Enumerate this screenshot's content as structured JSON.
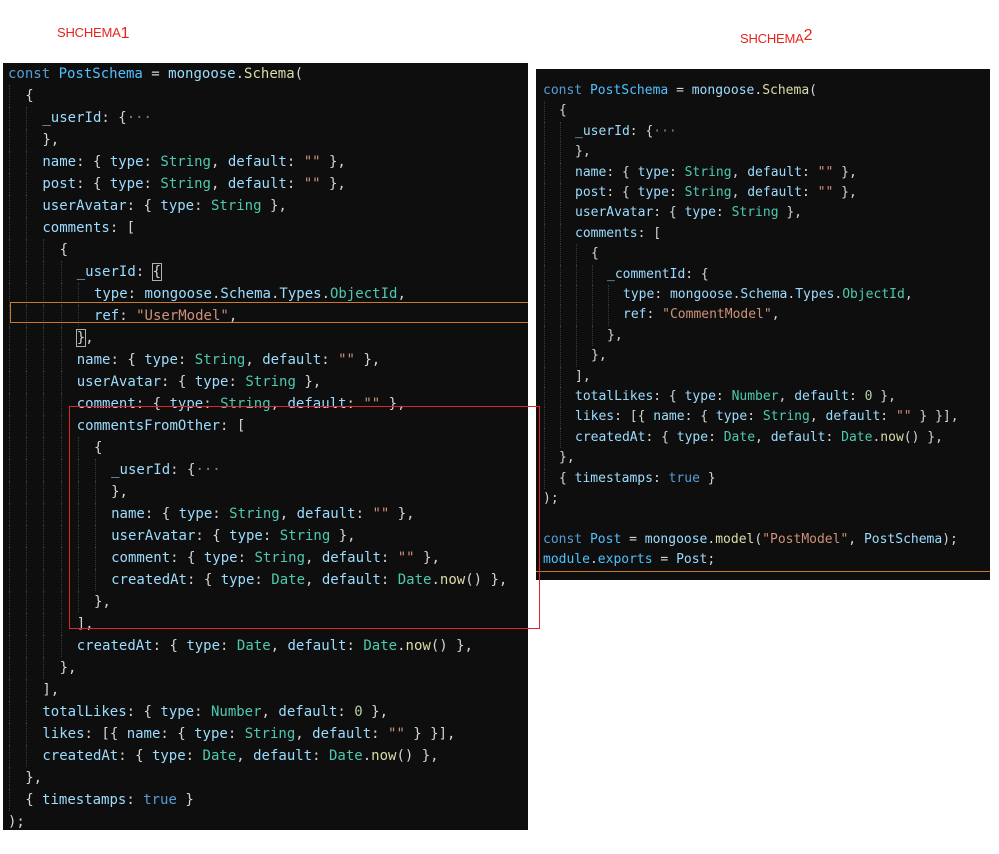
{
  "labels": {
    "schema1": {
      "text": "SHCHEMA",
      "num": "1"
    },
    "schema2": {
      "text": "SHCHEMA",
      "num": "2"
    }
  },
  "schema1": [
    [
      0,
      [
        [
          "kw",
          "const "
        ],
        [
          "var",
          "PostSchema"
        ],
        [
          "punc",
          " = "
        ],
        [
          "prop",
          "mongoose"
        ],
        [
          "punc",
          "."
        ],
        [
          "fn",
          "Schema"
        ],
        [
          "punc",
          "("
        ]
      ]
    ],
    [
      1,
      [
        [
          "punc",
          "{"
        ]
      ]
    ],
    [
      2,
      [
        [
          "prop",
          "_userId"
        ],
        [
          "punc",
          ": {"
        ],
        [
          "dim",
          "···"
        ]
      ]
    ],
    [
      2,
      [
        [
          "punc",
          "},"
        ]
      ]
    ],
    [
      2,
      [
        [
          "prop",
          "name"
        ],
        [
          "punc",
          ": { "
        ],
        [
          "prop",
          "type"
        ],
        [
          "punc",
          ": "
        ],
        [
          "type",
          "String"
        ],
        [
          "punc",
          ", "
        ],
        [
          "prop",
          "default"
        ],
        [
          "punc",
          ": "
        ],
        [
          "str",
          "\"\""
        ],
        [
          "punc",
          " },"
        ]
      ]
    ],
    [
      2,
      [
        [
          "prop",
          "post"
        ],
        [
          "punc",
          ": { "
        ],
        [
          "prop",
          "type"
        ],
        [
          "punc",
          ": "
        ],
        [
          "type",
          "String"
        ],
        [
          "punc",
          ", "
        ],
        [
          "prop",
          "default"
        ],
        [
          "punc",
          ": "
        ],
        [
          "str",
          "\"\""
        ],
        [
          "punc",
          " },"
        ]
      ]
    ],
    [
      2,
      [
        [
          "prop",
          "userAvatar"
        ],
        [
          "punc",
          ": { "
        ],
        [
          "prop",
          "type"
        ],
        [
          "punc",
          ": "
        ],
        [
          "type",
          "String"
        ],
        [
          "punc",
          " },"
        ]
      ]
    ],
    [
      2,
      [
        [
          "prop",
          "comments"
        ],
        [
          "punc",
          ": ["
        ]
      ]
    ],
    [
      3,
      [
        [
          "punc",
          "{"
        ]
      ]
    ],
    [
      4,
      [
        [
          "prop",
          "_userId"
        ],
        [
          "punc",
          ": "
        ],
        [
          "bracket",
          "{"
        ]
      ]
    ],
    [
      5,
      [
        [
          "prop",
          "type"
        ],
        [
          "punc",
          ": "
        ],
        [
          "prop",
          "mongoose"
        ],
        [
          "punc",
          "."
        ],
        [
          "prop",
          "Schema"
        ],
        [
          "punc",
          "."
        ],
        [
          "prop",
          "Types"
        ],
        [
          "punc",
          "."
        ],
        [
          "type",
          "ObjectId"
        ],
        [
          "punc",
          ","
        ]
      ]
    ],
    [
      5,
      [
        [
          "prop",
          "ref"
        ],
        [
          "punc",
          ": "
        ],
        [
          "str",
          "\"UserModel\""
        ],
        [
          "punc",
          ","
        ]
      ]
    ],
    [
      4,
      [
        [
          "bracket",
          "}"
        ],
        [
          "punc",
          ","
        ]
      ]
    ],
    [
      4,
      [
        [
          "prop",
          "name"
        ],
        [
          "punc",
          ": { "
        ],
        [
          "prop",
          "type"
        ],
        [
          "punc",
          ": "
        ],
        [
          "type",
          "String"
        ],
        [
          "punc",
          ", "
        ],
        [
          "prop",
          "default"
        ],
        [
          "punc",
          ": "
        ],
        [
          "str",
          "\"\""
        ],
        [
          "punc",
          " },"
        ]
      ]
    ],
    [
      4,
      [
        [
          "prop",
          "userAvatar"
        ],
        [
          "punc",
          ": { "
        ],
        [
          "prop",
          "type"
        ],
        [
          "punc",
          ": "
        ],
        [
          "type",
          "String"
        ],
        [
          "punc",
          " },"
        ]
      ]
    ],
    [
      4,
      [
        [
          "prop",
          "comment"
        ],
        [
          "punc",
          ": { "
        ],
        [
          "prop",
          "type"
        ],
        [
          "punc",
          ": "
        ],
        [
          "type",
          "String"
        ],
        [
          "punc",
          ", "
        ],
        [
          "prop",
          "default"
        ],
        [
          "punc",
          ": "
        ],
        [
          "str",
          "\"\""
        ],
        [
          "punc",
          " },"
        ]
      ]
    ],
    [
      4,
      [
        [
          "prop",
          "commentsFromOther"
        ],
        [
          "punc",
          ": ["
        ]
      ]
    ],
    [
      5,
      [
        [
          "punc",
          "{"
        ]
      ]
    ],
    [
      6,
      [
        [
          "prop",
          "_userId"
        ],
        [
          "punc",
          ": {"
        ],
        [
          "dim",
          "···"
        ]
      ]
    ],
    [
      6,
      [
        [
          "punc",
          "},"
        ]
      ]
    ],
    [
      6,
      [
        [
          "prop",
          "name"
        ],
        [
          "punc",
          ": { "
        ],
        [
          "prop",
          "type"
        ],
        [
          "punc",
          ": "
        ],
        [
          "type",
          "String"
        ],
        [
          "punc",
          ", "
        ],
        [
          "prop",
          "default"
        ],
        [
          "punc",
          ": "
        ],
        [
          "str",
          "\"\""
        ],
        [
          "punc",
          " },"
        ]
      ]
    ],
    [
      6,
      [
        [
          "prop",
          "userAvatar"
        ],
        [
          "punc",
          ": { "
        ],
        [
          "prop",
          "type"
        ],
        [
          "punc",
          ": "
        ],
        [
          "type",
          "String"
        ],
        [
          "punc",
          " },"
        ]
      ]
    ],
    [
      6,
      [
        [
          "prop",
          "comment"
        ],
        [
          "punc",
          ": { "
        ],
        [
          "prop",
          "type"
        ],
        [
          "punc",
          ": "
        ],
        [
          "type",
          "String"
        ],
        [
          "punc",
          ", "
        ],
        [
          "prop",
          "default"
        ],
        [
          "punc",
          ": "
        ],
        [
          "str",
          "\"\""
        ],
        [
          "punc",
          " },"
        ]
      ]
    ],
    [
      6,
      [
        [
          "prop",
          "createdAt"
        ],
        [
          "punc",
          ": { "
        ],
        [
          "prop",
          "type"
        ],
        [
          "punc",
          ": "
        ],
        [
          "type",
          "Date"
        ],
        [
          "punc",
          ", "
        ],
        [
          "prop",
          "default"
        ],
        [
          "punc",
          ": "
        ],
        [
          "type",
          "Date"
        ],
        [
          "punc",
          "."
        ],
        [
          "fn",
          "now"
        ],
        [
          "punc",
          "() },"
        ]
      ]
    ],
    [
      5,
      [
        [
          "punc",
          "},"
        ]
      ]
    ],
    [
      4,
      [
        [
          "punc",
          "],"
        ]
      ]
    ],
    [
      4,
      [
        [
          "prop",
          "createdAt"
        ],
        [
          "punc",
          ": { "
        ],
        [
          "prop",
          "type"
        ],
        [
          "punc",
          ": "
        ],
        [
          "type",
          "Date"
        ],
        [
          "punc",
          ", "
        ],
        [
          "prop",
          "default"
        ],
        [
          "punc",
          ": "
        ],
        [
          "type",
          "Date"
        ],
        [
          "punc",
          "."
        ],
        [
          "fn",
          "now"
        ],
        [
          "punc",
          "() },"
        ]
      ]
    ],
    [
      3,
      [
        [
          "punc",
          "},"
        ]
      ]
    ],
    [
      2,
      [
        [
          "punc",
          "],"
        ]
      ]
    ],
    [
      2,
      [
        [
          "prop",
          "totalLikes"
        ],
        [
          "punc",
          ": { "
        ],
        [
          "prop",
          "type"
        ],
        [
          "punc",
          ": "
        ],
        [
          "type",
          "Number"
        ],
        [
          "punc",
          ", "
        ],
        [
          "prop",
          "default"
        ],
        [
          "punc",
          ": "
        ],
        [
          "num",
          "0"
        ],
        [
          "punc",
          " },"
        ]
      ]
    ],
    [
      2,
      [
        [
          "prop",
          "likes"
        ],
        [
          "punc",
          ": [{ "
        ],
        [
          "prop",
          "name"
        ],
        [
          "punc",
          ": { "
        ],
        [
          "prop",
          "type"
        ],
        [
          "punc",
          ": "
        ],
        [
          "type",
          "String"
        ],
        [
          "punc",
          ", "
        ],
        [
          "prop",
          "default"
        ],
        [
          "punc",
          ": "
        ],
        [
          "str",
          "\"\""
        ],
        [
          "punc",
          " } }],"
        ]
      ]
    ],
    [
      2,
      [
        [
          "prop",
          "createdAt"
        ],
        [
          "punc",
          ": { "
        ],
        [
          "prop",
          "type"
        ],
        [
          "punc",
          ": "
        ],
        [
          "type",
          "Date"
        ],
        [
          "punc",
          ", "
        ],
        [
          "prop",
          "default"
        ],
        [
          "punc",
          ": "
        ],
        [
          "type",
          "Date"
        ],
        [
          "punc",
          "."
        ],
        [
          "fn",
          "now"
        ],
        [
          "punc",
          "() },"
        ]
      ]
    ],
    [
      1,
      [
        [
          "punc",
          "},"
        ]
      ]
    ],
    [
      1,
      [
        [
          "punc",
          "{ "
        ],
        [
          "prop",
          "timestamps"
        ],
        [
          "punc",
          ": "
        ],
        [
          "bool",
          "true"
        ],
        [
          "punc",
          " }"
        ]
      ]
    ],
    [
      0,
      [
        [
          "punc",
          ");"
        ]
      ]
    ]
  ],
  "schema2": [
    [
      0,
      [
        [
          "kw",
          "const "
        ],
        [
          "var",
          "PostSchema"
        ],
        [
          "punc",
          " = "
        ],
        [
          "prop",
          "mongoose"
        ],
        [
          "punc",
          "."
        ],
        [
          "fn",
          "Schema"
        ],
        [
          "punc",
          "("
        ]
      ]
    ],
    [
      1,
      [
        [
          "punc",
          "{"
        ]
      ]
    ],
    [
      2,
      [
        [
          "prop",
          "_userId"
        ],
        [
          "punc",
          ": {"
        ],
        [
          "dim",
          "···"
        ]
      ]
    ],
    [
      2,
      [
        [
          "punc",
          "},"
        ]
      ]
    ],
    [
      2,
      [
        [
          "prop",
          "name"
        ],
        [
          "punc",
          ": { "
        ],
        [
          "prop",
          "type"
        ],
        [
          "punc",
          ": "
        ],
        [
          "type",
          "String"
        ],
        [
          "punc",
          ", "
        ],
        [
          "prop",
          "default"
        ],
        [
          "punc",
          ": "
        ],
        [
          "str",
          "\"\""
        ],
        [
          "punc",
          " },"
        ]
      ]
    ],
    [
      2,
      [
        [
          "prop",
          "post"
        ],
        [
          "punc",
          ": { "
        ],
        [
          "prop",
          "type"
        ],
        [
          "punc",
          ": "
        ],
        [
          "type",
          "String"
        ],
        [
          "punc",
          ", "
        ],
        [
          "prop",
          "default"
        ],
        [
          "punc",
          ": "
        ],
        [
          "str",
          "\"\""
        ],
        [
          "punc",
          " },"
        ]
      ]
    ],
    [
      2,
      [
        [
          "prop",
          "userAvatar"
        ],
        [
          "punc",
          ": { "
        ],
        [
          "prop",
          "type"
        ],
        [
          "punc",
          ": "
        ],
        [
          "type",
          "String"
        ],
        [
          "punc",
          " },"
        ]
      ]
    ],
    [
      2,
      [
        [
          "prop",
          "comments"
        ],
        [
          "punc",
          ": ["
        ]
      ]
    ],
    [
      3,
      [
        [
          "punc",
          "{"
        ]
      ]
    ],
    [
      4,
      [
        [
          "prop",
          "_commentId"
        ],
        [
          "punc",
          ": {"
        ]
      ]
    ],
    [
      5,
      [
        [
          "prop",
          "type"
        ],
        [
          "punc",
          ": "
        ],
        [
          "prop",
          "mongoose"
        ],
        [
          "punc",
          "."
        ],
        [
          "prop",
          "Schema"
        ],
        [
          "punc",
          "."
        ],
        [
          "prop",
          "Types"
        ],
        [
          "punc",
          "."
        ],
        [
          "type",
          "ObjectId"
        ],
        [
          "punc",
          ","
        ]
      ]
    ],
    [
      5,
      [
        [
          "prop",
          "ref"
        ],
        [
          "punc",
          ": "
        ],
        [
          "str",
          "\"CommentModel\""
        ],
        [
          "punc",
          ","
        ]
      ]
    ],
    [
      4,
      [
        [
          "punc",
          "},"
        ]
      ]
    ],
    [
      3,
      [
        [
          "punc",
          "},"
        ]
      ]
    ],
    [
      2,
      [
        [
          "punc",
          "],"
        ]
      ]
    ],
    [
      2,
      [
        [
          "prop",
          "totalLikes"
        ],
        [
          "punc",
          ": { "
        ],
        [
          "prop",
          "type"
        ],
        [
          "punc",
          ": "
        ],
        [
          "type",
          "Number"
        ],
        [
          "punc",
          ", "
        ],
        [
          "prop",
          "default"
        ],
        [
          "punc",
          ": "
        ],
        [
          "num",
          "0"
        ],
        [
          "punc",
          " },"
        ]
      ]
    ],
    [
      2,
      [
        [
          "prop",
          "likes"
        ],
        [
          "punc",
          ": [{ "
        ],
        [
          "prop",
          "name"
        ],
        [
          "punc",
          ": { "
        ],
        [
          "prop",
          "type"
        ],
        [
          "punc",
          ": "
        ],
        [
          "type",
          "String"
        ],
        [
          "punc",
          ", "
        ],
        [
          "prop",
          "default"
        ],
        [
          "punc",
          ": "
        ],
        [
          "str",
          "\"\""
        ],
        [
          "punc",
          " } }],"
        ]
      ]
    ],
    [
      2,
      [
        [
          "prop",
          "createdAt"
        ],
        [
          "punc",
          ": { "
        ],
        [
          "prop",
          "type"
        ],
        [
          "punc",
          ": "
        ],
        [
          "type",
          "Date"
        ],
        [
          "punc",
          ", "
        ],
        [
          "prop",
          "default"
        ],
        [
          "punc",
          ": "
        ],
        [
          "type",
          "Date"
        ],
        [
          "punc",
          "."
        ],
        [
          "fn",
          "now"
        ],
        [
          "punc",
          "() },"
        ]
      ]
    ],
    [
      1,
      [
        [
          "punc",
          "},"
        ]
      ]
    ],
    [
      1,
      [
        [
          "punc",
          "{ "
        ],
        [
          "prop",
          "timestamps"
        ],
        [
          "punc",
          ": "
        ],
        [
          "bool",
          "true"
        ],
        [
          "punc",
          " }"
        ]
      ]
    ],
    [
      0,
      [
        [
          "punc",
          ");"
        ]
      ]
    ],
    [
      0,
      []
    ],
    [
      0,
      [
        [
          "kw",
          "const "
        ],
        [
          "var",
          "Post"
        ],
        [
          "punc",
          " = "
        ],
        [
          "prop",
          "mongoose"
        ],
        [
          "punc",
          "."
        ],
        [
          "fn",
          "model"
        ],
        [
          "punc",
          "("
        ],
        [
          "str",
          "\"PostModel\""
        ],
        [
          "punc",
          ", "
        ],
        [
          "prop",
          "PostSchema"
        ],
        [
          "punc",
          ");"
        ]
      ]
    ],
    [
      0,
      [
        [
          "var",
          "module"
        ],
        [
          "punc",
          "."
        ],
        [
          "var",
          "exports"
        ],
        [
          "punc",
          " = "
        ],
        [
          "prop",
          "Post"
        ],
        [
          "punc",
          ";"
        ]
      ]
    ]
  ]
}
